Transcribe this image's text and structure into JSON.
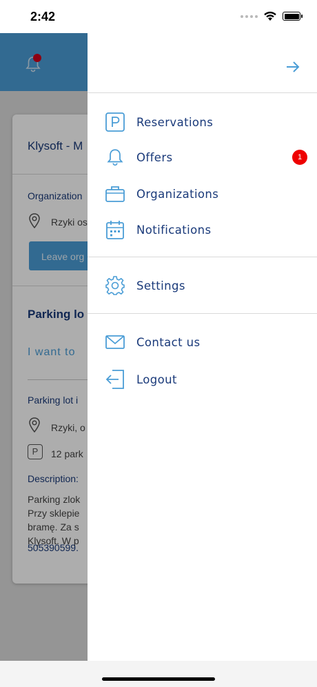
{
  "status_bar": {
    "time": "2:42"
  },
  "background": {
    "card_title": "Klysoft - M",
    "organization_label": "Organization",
    "organization_address": "Rzyki os",
    "leave_button": "Leave org",
    "parking_title": "Parking lo",
    "want_link": "I want to",
    "parking_info_label": "Parking lot i",
    "parking_address": "Rzyki, o",
    "parking_spaces": "12 park",
    "description_label": "Description:",
    "description_lines": [
      "Parking zlok",
      "Przy sklepie",
      "bramę. Za s",
      "Klysoft. W p"
    ],
    "phone": "505390599."
  },
  "drawer": {
    "items": [
      {
        "label": "Reservations",
        "icon": "parking-icon"
      },
      {
        "label": "Offers",
        "icon": "bell-icon",
        "badge": "1"
      },
      {
        "label": "Organizations",
        "icon": "briefcase-icon"
      },
      {
        "label": "Notifications",
        "icon": "calendar-icon"
      },
      {
        "label": "Settings",
        "icon": "gear-icon"
      },
      {
        "label": "Contact us",
        "icon": "envelope-icon"
      },
      {
        "label": "Logout",
        "icon": "logout-icon"
      }
    ]
  },
  "colors": {
    "accent": "#4a9dd6",
    "text": "#1a3a7a",
    "badge": "#ee0000"
  }
}
